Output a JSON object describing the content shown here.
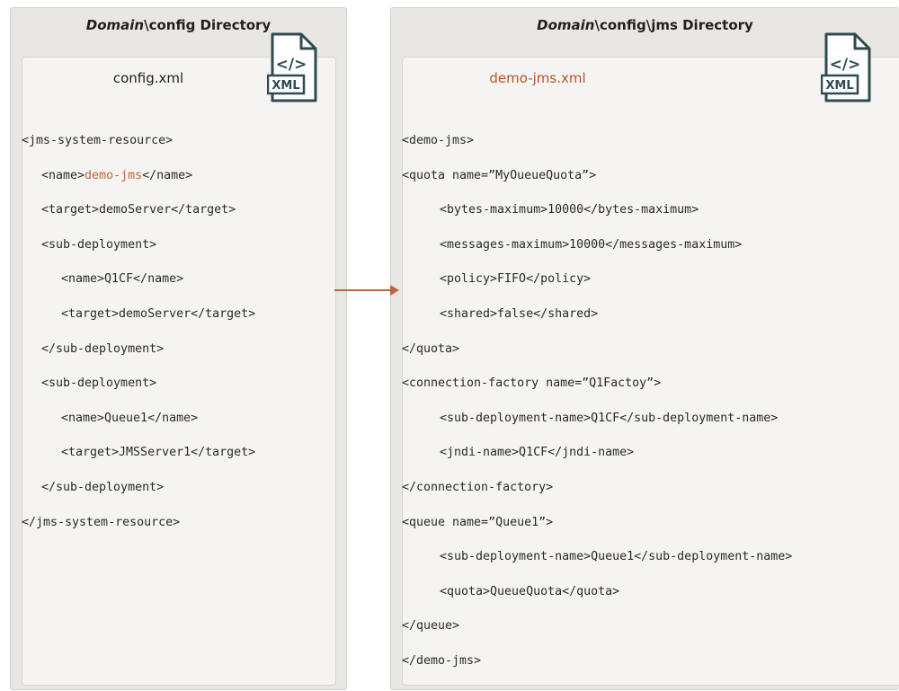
{
  "left_panel": {
    "title_domain": "Domain",
    "title_rest": "\\config Directory",
    "file_name": "config.xml",
    "icon_label": "XML",
    "lines": [
      {
        "indent": 0,
        "text": "<jms-system-resource>"
      },
      {
        "indent": 1,
        "pre": "<name>",
        "hl": "demo-jms",
        "post": "</name>"
      },
      {
        "indent": 1,
        "text": "<target>demoServer</target>"
      },
      {
        "indent": 1,
        "text": "<sub-deployment>"
      },
      {
        "indent": 2,
        "text": "<name>Q1CF</name>"
      },
      {
        "indent": 2,
        "text": "<target>demoServer</target>"
      },
      {
        "indent": 1,
        "text": "</sub-deployment>"
      },
      {
        "indent": 1,
        "text": "<sub-deployment>"
      },
      {
        "indent": 2,
        "text": "<name>Queue1</name>"
      },
      {
        "indent": 2,
        "text": "<target>JMSServer1</target>"
      },
      {
        "indent": 1,
        "text": "</sub-deployment>"
      },
      {
        "indent": 0,
        "text": "</jms-system-resource>"
      }
    ]
  },
  "right_panel": {
    "title_domain": "Domain",
    "title_rest": "\\config\\jms Directory",
    "file_name": "demo-jms.xml",
    "icon_label": "XML",
    "lines": [
      {
        "indent": 0,
        "text": "<demo-jms>"
      },
      {
        "indent": 0,
        "text": "<quota name=”MyOueueQuota”>"
      },
      {
        "indent": 1,
        "text": "<bytes-maximum>10000</bytes-maximum>"
      },
      {
        "indent": 1,
        "text": "<messages-maximum>10000</messages-maximum>"
      },
      {
        "indent": 1,
        "text": "<policy>FIFO</policy>"
      },
      {
        "indent": 1,
        "text": "<shared>false</shared>"
      },
      {
        "indent": 0,
        "text": "</quota>"
      },
      {
        "indent": 0,
        "text": "<connection-factory name=”Q1Factoy”>"
      },
      {
        "indent": 1,
        "text": "<sub-deployment-name>Q1CF</sub-deployment-name>"
      },
      {
        "indent": 1,
        "text": "<jndi-name>Q1CF</jndi-name>"
      },
      {
        "indent": 0,
        "text": "</connection-factory>"
      },
      {
        "indent": 0,
        "text": "<queue name=”Queue1”>"
      },
      {
        "indent": 1,
        "text": "<sub-deployment-name>Queue1</sub-deployment-name>"
      },
      {
        "indent": 1,
        "text": "<quota>QueueQuota</quota>"
      },
      {
        "indent": 0,
        "text": "</queue>"
      },
      {
        "indent": 0,
        "text": "</demo-jms>"
      }
    ]
  },
  "colors": {
    "highlight": "#c0643c",
    "arrow": "#c0643c",
    "icon": "#2f4a52"
  }
}
